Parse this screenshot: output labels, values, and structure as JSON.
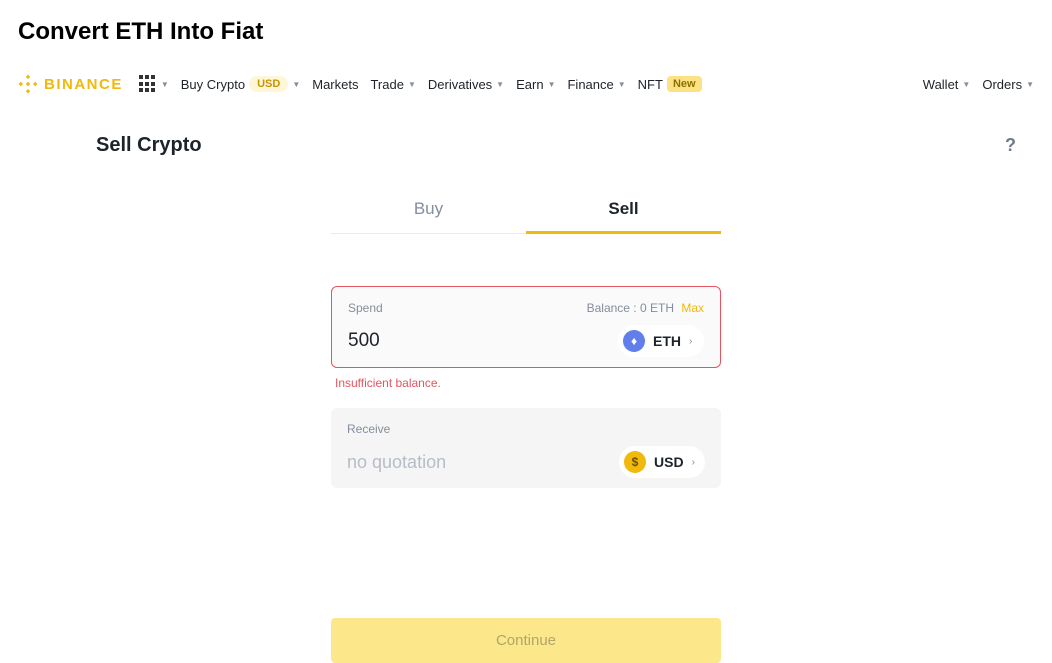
{
  "heading": "Convert ETH Into Fiat",
  "brand": "BINANCE",
  "nav": {
    "buyCrypto": "Buy Crypto",
    "buyCryptoBadge": "USD",
    "markets": "Markets",
    "trade": "Trade",
    "derivatives": "Derivatives",
    "earn": "Earn",
    "finance": "Finance",
    "nft": "NFT",
    "nftBadge": "New",
    "wallet": "Wallet",
    "orders": "Orders"
  },
  "sectionTitle": "Sell Crypto",
  "tabs": {
    "buy": "Buy",
    "sell": "Sell"
  },
  "spend": {
    "label": "Spend",
    "balanceLabel": "Balance : 0 ETH",
    "max": "Max",
    "value": "500",
    "coin": "ETH",
    "error": "Insufficient balance."
  },
  "receive": {
    "label": "Receive",
    "placeholder": "no quotation",
    "coin": "USD"
  },
  "continueLabel": "Continue"
}
